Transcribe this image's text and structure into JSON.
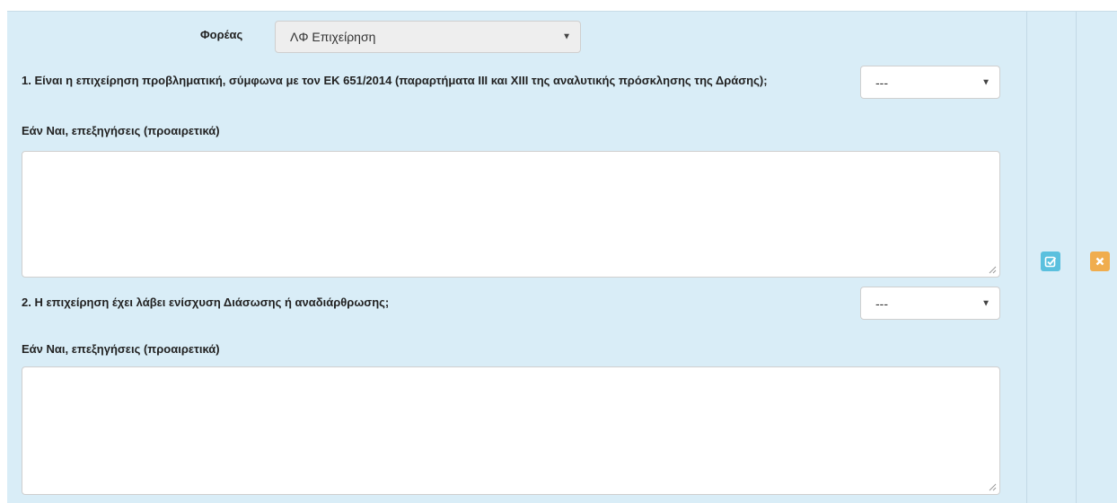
{
  "carrier": {
    "label": "Φορέας",
    "value": "ΛΦ Επιχείρηση"
  },
  "question1": {
    "text": "1. Είναι η επιχείρηση προβληματική, σύμφωνα με τον ΕΚ 651/2014 (παραρτήματα III και XIII της αναλυτικής πρόσκλησης της Δράσης);",
    "selected": "---",
    "explain_label": "Εάν Ναι, επεξηγήσεις (προαιρετικά)",
    "explain_value": ""
  },
  "question2": {
    "text": "2. Η επιχείρηση έχει λάβει ενίσχυση Διάσωσης ή αναδιάρθρωσης;",
    "selected": "---",
    "explain_label": "Εάν Ναι, επεξηγήσεις (προαιρετικά)",
    "explain_value": ""
  },
  "actions": {
    "edit_icon": "edit-checkbox-icon",
    "delete_icon": "close-icon",
    "edit_color": "#5bc0de",
    "delete_color": "#f0ad4e"
  }
}
